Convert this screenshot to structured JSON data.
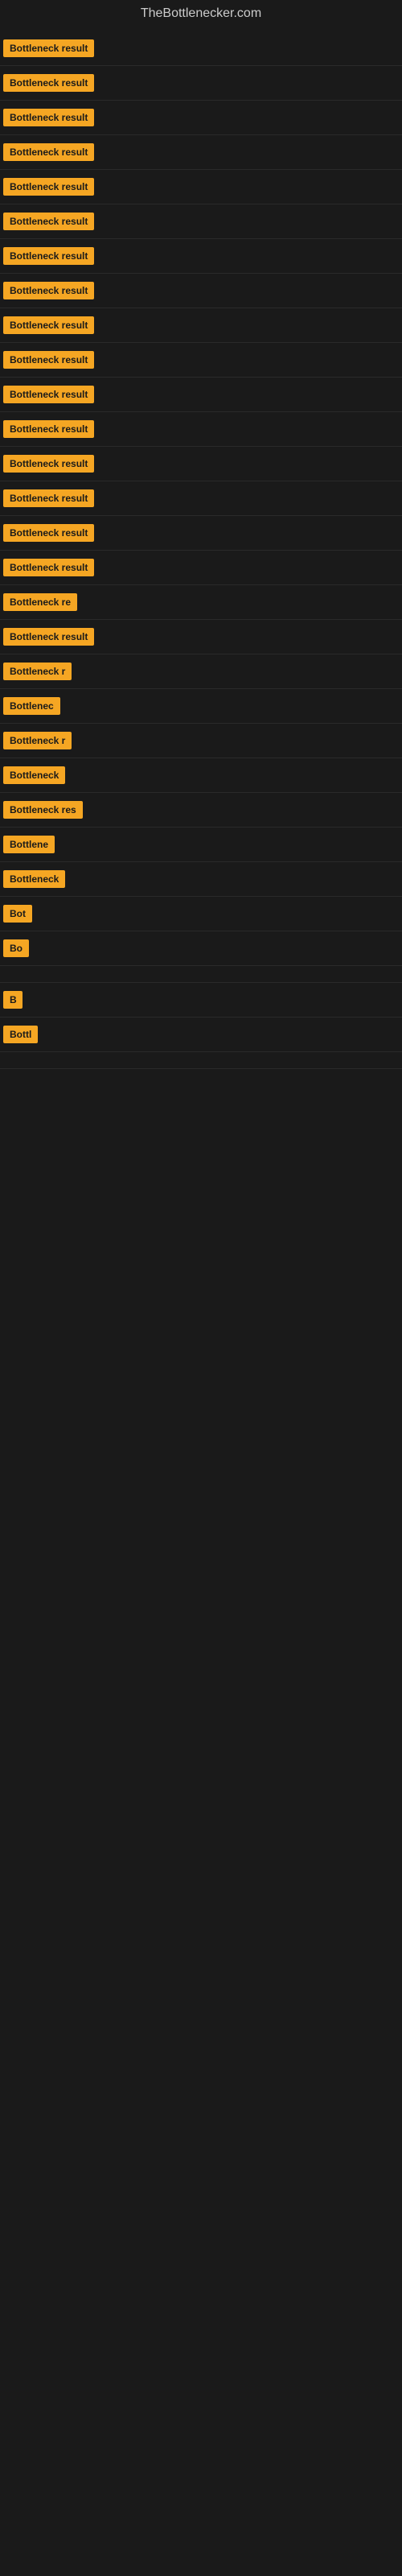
{
  "header": {
    "title": "TheBottlenecker.com"
  },
  "items": [
    {
      "label": "Bottleneck result",
      "width": 135
    },
    {
      "label": "Bottleneck result",
      "width": 135
    },
    {
      "label": "Bottleneck result",
      "width": 135
    },
    {
      "label": "Bottleneck result",
      "width": 130
    },
    {
      "label": "Bottleneck result",
      "width": 135
    },
    {
      "label": "Bottleneck result",
      "width": 130
    },
    {
      "label": "Bottleneck result",
      "width": 130
    },
    {
      "label": "Bottleneck result",
      "width": 128
    },
    {
      "label": "Bottleneck result",
      "width": 125
    },
    {
      "label": "Bottleneck result",
      "width": 122
    },
    {
      "label": "Bottleneck result",
      "width": 122
    },
    {
      "label": "Bottleneck result",
      "width": 120
    },
    {
      "label": "Bottleneck result",
      "width": 118
    },
    {
      "label": "Bottleneck result",
      "width": 115
    },
    {
      "label": "Bottleneck result",
      "width": 113
    },
    {
      "label": "Bottleneck result",
      "width": 110
    },
    {
      "label": "Bottleneck re",
      "width": 95
    },
    {
      "label": "Bottleneck result",
      "width": 108
    },
    {
      "label": "Bottleneck r",
      "width": 88
    },
    {
      "label": "Bottlenec",
      "width": 78
    },
    {
      "label": "Bottleneck r",
      "width": 88
    },
    {
      "label": "Bottleneck",
      "width": 75
    },
    {
      "label": "Bottleneck res",
      "width": 98
    },
    {
      "label": "Bottlene",
      "width": 68
    },
    {
      "label": "Bottleneck",
      "width": 75
    },
    {
      "label": "Bot",
      "width": 38
    },
    {
      "label": "Bo",
      "width": 28
    },
    {
      "label": "",
      "width": 8
    },
    {
      "label": "B",
      "width": 14
    },
    {
      "label": "Bottl",
      "width": 42
    },
    {
      "label": "",
      "width": 4
    }
  ]
}
